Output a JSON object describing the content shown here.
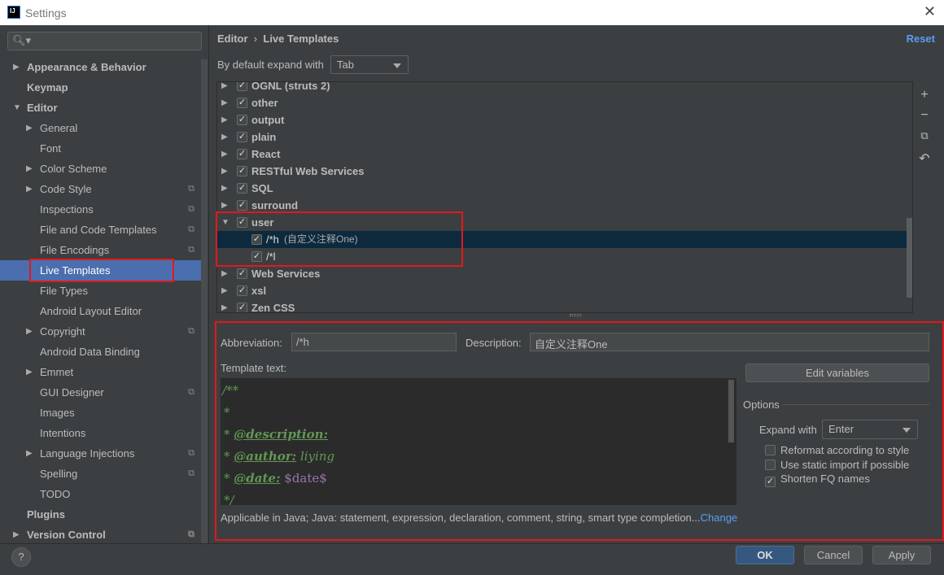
{
  "window": {
    "title": "Settings",
    "close": "✕",
    "logo": "IJ"
  },
  "sidebar": {
    "search_icon": "search-icon",
    "items": [
      {
        "label": "Appearance & Behavior",
        "level": 0,
        "arrow": "▶",
        "bold": true
      },
      {
        "label": "Keymap",
        "level": 0,
        "bold": true
      },
      {
        "label": "Editor",
        "level": 0,
        "arrow": "▼",
        "bold": true
      },
      {
        "label": "General",
        "level": 1,
        "arrow": "▶"
      },
      {
        "label": "Font",
        "level": 1
      },
      {
        "label": "Color Scheme",
        "level": 1,
        "arrow": "▶"
      },
      {
        "label": "Code Style",
        "level": 1,
        "arrow": "▶",
        "copy": true
      },
      {
        "label": "Inspections",
        "level": 1,
        "copy": true
      },
      {
        "label": "File and Code Templates",
        "level": 1,
        "copy": true
      },
      {
        "label": "File Encodings",
        "level": 1,
        "copy": true
      },
      {
        "label": "Live Templates",
        "level": 1,
        "selected": true
      },
      {
        "label": "File Types",
        "level": 1
      },
      {
        "label": "Android Layout Editor",
        "level": 1
      },
      {
        "label": "Copyright",
        "level": 1,
        "arrow": "▶",
        "copy": true
      },
      {
        "label": "Android Data Binding",
        "level": 1
      },
      {
        "label": "Emmet",
        "level": 1,
        "arrow": "▶"
      },
      {
        "label": "GUI Designer",
        "level": 1,
        "copy": true
      },
      {
        "label": "Images",
        "level": 1
      },
      {
        "label": "Intentions",
        "level": 1
      },
      {
        "label": "Language Injections",
        "level": 1,
        "arrow": "▶",
        "copy": true
      },
      {
        "label": "Spelling",
        "level": 1,
        "copy": true
      },
      {
        "label": "TODO",
        "level": 1
      },
      {
        "label": "Plugins",
        "level": 0,
        "bold": true
      },
      {
        "label": "Version Control",
        "level": 0,
        "arrow": "▶",
        "bold": true,
        "copy": true
      }
    ]
  },
  "header": {
    "breadcrumb_parent": "Editor",
    "separator": "›",
    "breadcrumb_current": "Live Templates",
    "reset": "Reset",
    "expand_label": "By default expand with",
    "expand_value": "Tab"
  },
  "tree": [
    {
      "label": "OGNL (struts 2)",
      "arrow": "▶",
      "checked": true
    },
    {
      "label": "other",
      "arrow": "▶",
      "checked": true
    },
    {
      "label": "output",
      "arrow": "▶",
      "checked": true
    },
    {
      "label": "plain",
      "arrow": "▶",
      "checked": true
    },
    {
      "label": "React",
      "arrow": "▶",
      "checked": true
    },
    {
      "label": "RESTful Web Services",
      "arrow": "▶",
      "checked": true
    },
    {
      "label": "SQL",
      "arrow": "▶",
      "checked": true
    },
    {
      "label": "surround",
      "arrow": "▶",
      "checked": true
    },
    {
      "label": "user",
      "arrow": "▼",
      "checked": true
    },
    {
      "label": "/*h",
      "desc": "(自定义注释One)",
      "child": true,
      "checked": true,
      "selected": true
    },
    {
      "label": "/*l",
      "child": true,
      "checked": true
    },
    {
      "label": "Web Services",
      "arrow": "▶",
      "checked": true
    },
    {
      "label": "xsl",
      "arrow": "▶",
      "checked": true
    },
    {
      "label": "Zen CSS",
      "arrow": "▶",
      "checked": true
    }
  ],
  "toolbar": {
    "add": "+",
    "remove": "−",
    "copy": "⧉",
    "revert": "↶"
  },
  "detail": {
    "abbr_label": "Abbreviation:",
    "abbr_value": "/*h",
    "desc_label": "Description:",
    "desc_value": "自定义注释One",
    "template_label": "Template text:",
    "template_lines": [
      "/**",
      " *",
      " * @description:",
      " * @author: liying",
      " * @date: $date$",
      " */"
    ],
    "applicable": "Applicable in Java; Java: statement, expression, declaration, comment, string, smart type completion...",
    "change": "Change",
    "edit_variables": "Edit variables",
    "options_label": "Options",
    "expand_with_label": "Expand with",
    "expand_with_value": "Enter",
    "options": [
      {
        "label": "Reformat according to style",
        "checked": false
      },
      {
        "label": "Use static import if possible",
        "checked": false
      },
      {
        "label": "Shorten FQ names",
        "checked": true
      }
    ]
  },
  "footer": {
    "help": "?",
    "ok": "OK",
    "cancel": "Cancel",
    "apply": "Apply"
  }
}
